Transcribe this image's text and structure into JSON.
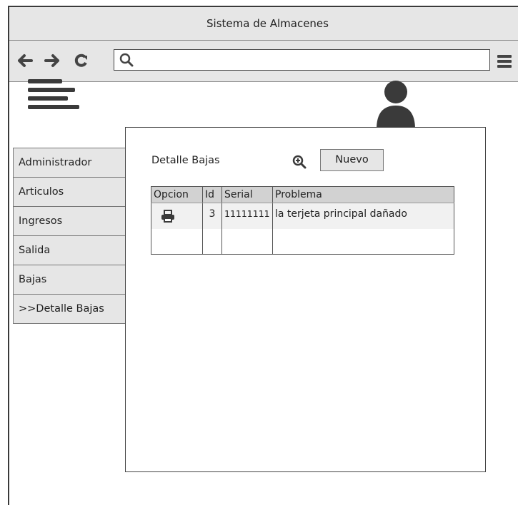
{
  "window": {
    "title": "Sistema de Almacenes"
  },
  "browser": {
    "back_glyph": "⬅",
    "forward_glyph": "➡",
    "reload_glyph": "C",
    "address": ""
  },
  "sidebar": {
    "items": [
      {
        "label": "Administrador"
      },
      {
        "label": "Articulos"
      },
      {
        "label": "Ingresos"
      },
      {
        "label": "Salida"
      },
      {
        "label": "Bajas"
      },
      {
        "label": ">>Detalle Bajas"
      }
    ]
  },
  "main": {
    "title": "Detalle Bajas",
    "new_button_label": "Nuevo",
    "table": {
      "columns": [
        "Opcion",
        "Id",
        "Serial",
        "Problema"
      ],
      "rows": [
        {
          "opcion_icon": "printer-icon",
          "id": "3",
          "serial": "11111111",
          "problema": "la terjeta principal dañado"
        }
      ]
    }
  },
  "colors": {
    "chrome": "#e6e6e6",
    "table_header": "#d2d2d2",
    "icon": "#3a3a3a"
  }
}
